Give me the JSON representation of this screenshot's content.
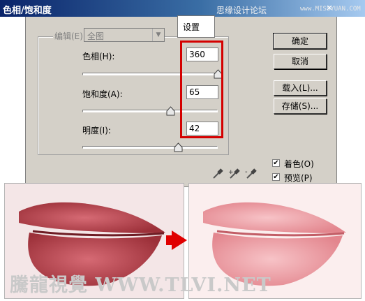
{
  "window": {
    "title": "色相/饱和度",
    "close_glyph": "✕",
    "watermark_site_cn": "思缘设计论坛",
    "watermark_site_url": "www.MISSYUAN.COM"
  },
  "edit": {
    "label": "编辑(E):",
    "value": "全图",
    "arrow_glyph": "▼"
  },
  "controls": [
    {
      "label": "色相(H):",
      "value": "360",
      "level_fraction": 1.0
    },
    {
      "label": "饱和度(A):",
      "value": "65",
      "level_fraction": 0.65
    },
    {
      "label": "明度(I):",
      "value": "42",
      "level_fraction": 0.71
    }
  ],
  "buttons": {
    "ok": "确定",
    "cancel": "取消",
    "load": "载入(L)...",
    "save": "存储(S)..."
  },
  "options": {
    "colorize": {
      "label": "着色(O)",
      "checked": true,
      "mark": "✔"
    },
    "preview": {
      "label": "预览(P)",
      "checked": true,
      "mark": "✔"
    }
  },
  "annotation": {
    "callout": "设置",
    "color": "#d40000"
  },
  "bottom_watermark": "騰龍視覺 WWW.TLVI.NET",
  "colors": {
    "dialog_bg": "#d4d0c8",
    "title_start": "#0a246a",
    "lips_before": "#b8454d",
    "lips_after": "#ef9fa6",
    "arrow": "#e00000"
  }
}
